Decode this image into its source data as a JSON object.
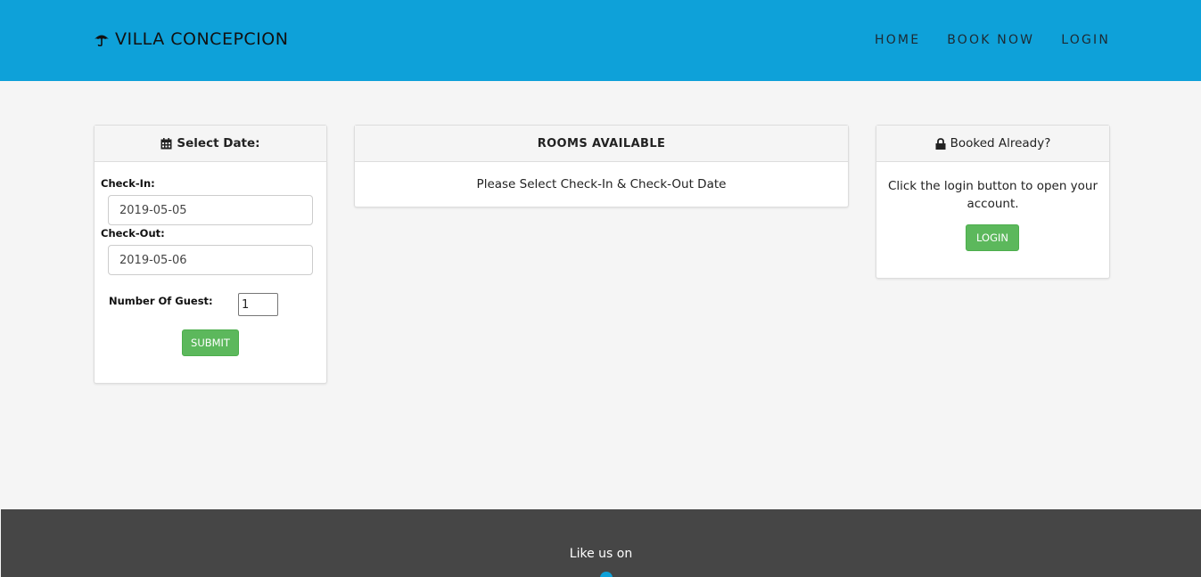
{
  "navbar": {
    "brand": "VILLA CONCEPCION",
    "brand_icon": "umbrella-icon",
    "links": [
      "HOME",
      "BOOK NOW",
      "LOGIN"
    ],
    "bg_color": "#0ea1d9"
  },
  "date_panel": {
    "title": "Select Date:",
    "title_icon": "calendar-icon",
    "checkin_label": "Check-In:",
    "checkin_value": "2019-05-05",
    "checkout_label": "Check-Out:",
    "checkout_value": "2019-05-06",
    "guest_label": "Number Of Guest:",
    "guest_value": "1",
    "submit_label": "SUBMIT"
  },
  "rooms_panel": {
    "title": "ROOMS AVAILABLE",
    "message": "Please Select Check-In & Check-Out Date"
  },
  "booked_panel": {
    "title": "Booked Already?",
    "title_icon": "lock-icon",
    "message": "Click the login button to open your account.",
    "login_label": "LOGIN"
  },
  "footer": {
    "text": "Like us on",
    "bg_color": "#464646"
  },
  "colors": {
    "button_green": "#5cb85c"
  }
}
